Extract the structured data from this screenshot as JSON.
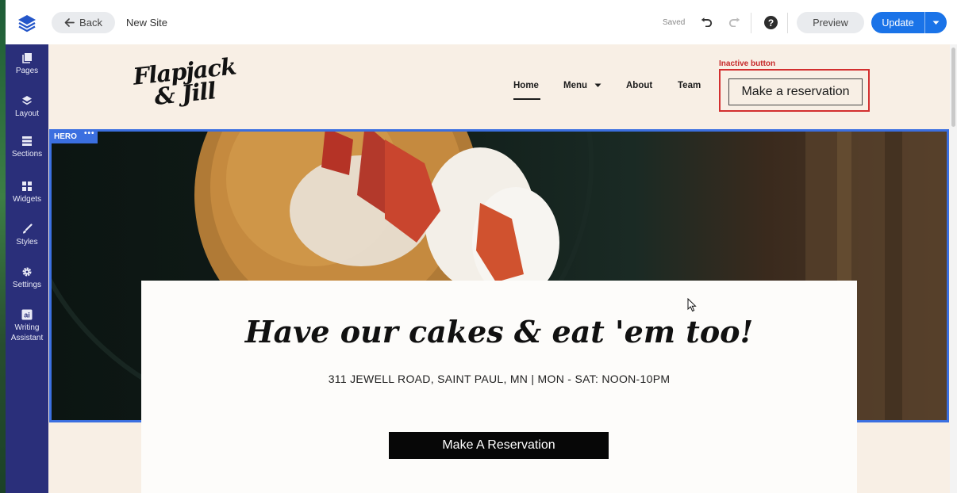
{
  "topbar": {
    "back_label": "Back",
    "site_name": "New Site",
    "save_status": "Saved",
    "preview_label": "Preview",
    "update_label": "Update",
    "icons": [
      "logo-icon",
      "arrow-left-icon",
      "undo-icon",
      "redo-icon",
      "help-icon",
      "chevron-down-icon"
    ]
  },
  "sidebar": {
    "items": [
      {
        "label": "Pages",
        "icon": "pages-icon"
      },
      {
        "label": "Layout",
        "icon": "layers-icon"
      },
      {
        "label": "Sections",
        "icon": "sections-icon"
      },
      {
        "label": "Widgets",
        "icon": "widgets-icon"
      },
      {
        "label": "Styles",
        "icon": "brush-icon"
      },
      {
        "label": "Settings",
        "icon": "gear-icon"
      },
      {
        "label": "Writing Assistant",
        "icon": "ai-icon",
        "icon_text": "ai"
      }
    ]
  },
  "site": {
    "brand_line1": "Flapjack",
    "brand_line2": "& Jill",
    "nav": [
      {
        "label": "Home",
        "active": true
      },
      {
        "label": "Menu",
        "has_dropdown": true
      },
      {
        "label": "About"
      },
      {
        "label": "Team"
      }
    ],
    "annotation_label": "Inactive button",
    "header_button_label": "Make a reservation",
    "hero_badge": "HERO",
    "hero_badge_menu": "•••",
    "tagline": "Have our cakes & eat 'em too!",
    "address": "311 JEWELL ROAD, SAINT PAUL, MN | MON - SAT: NOON-10PM",
    "cta_label": "Make A Reservation"
  },
  "colors": {
    "sidebar_bg": "#2a2f7a",
    "accent_blue": "#1a73e8",
    "selection_blue": "#3b6fe0",
    "annotation_red": "#d32f2f",
    "canvas_bg": "#f8efe5"
  }
}
